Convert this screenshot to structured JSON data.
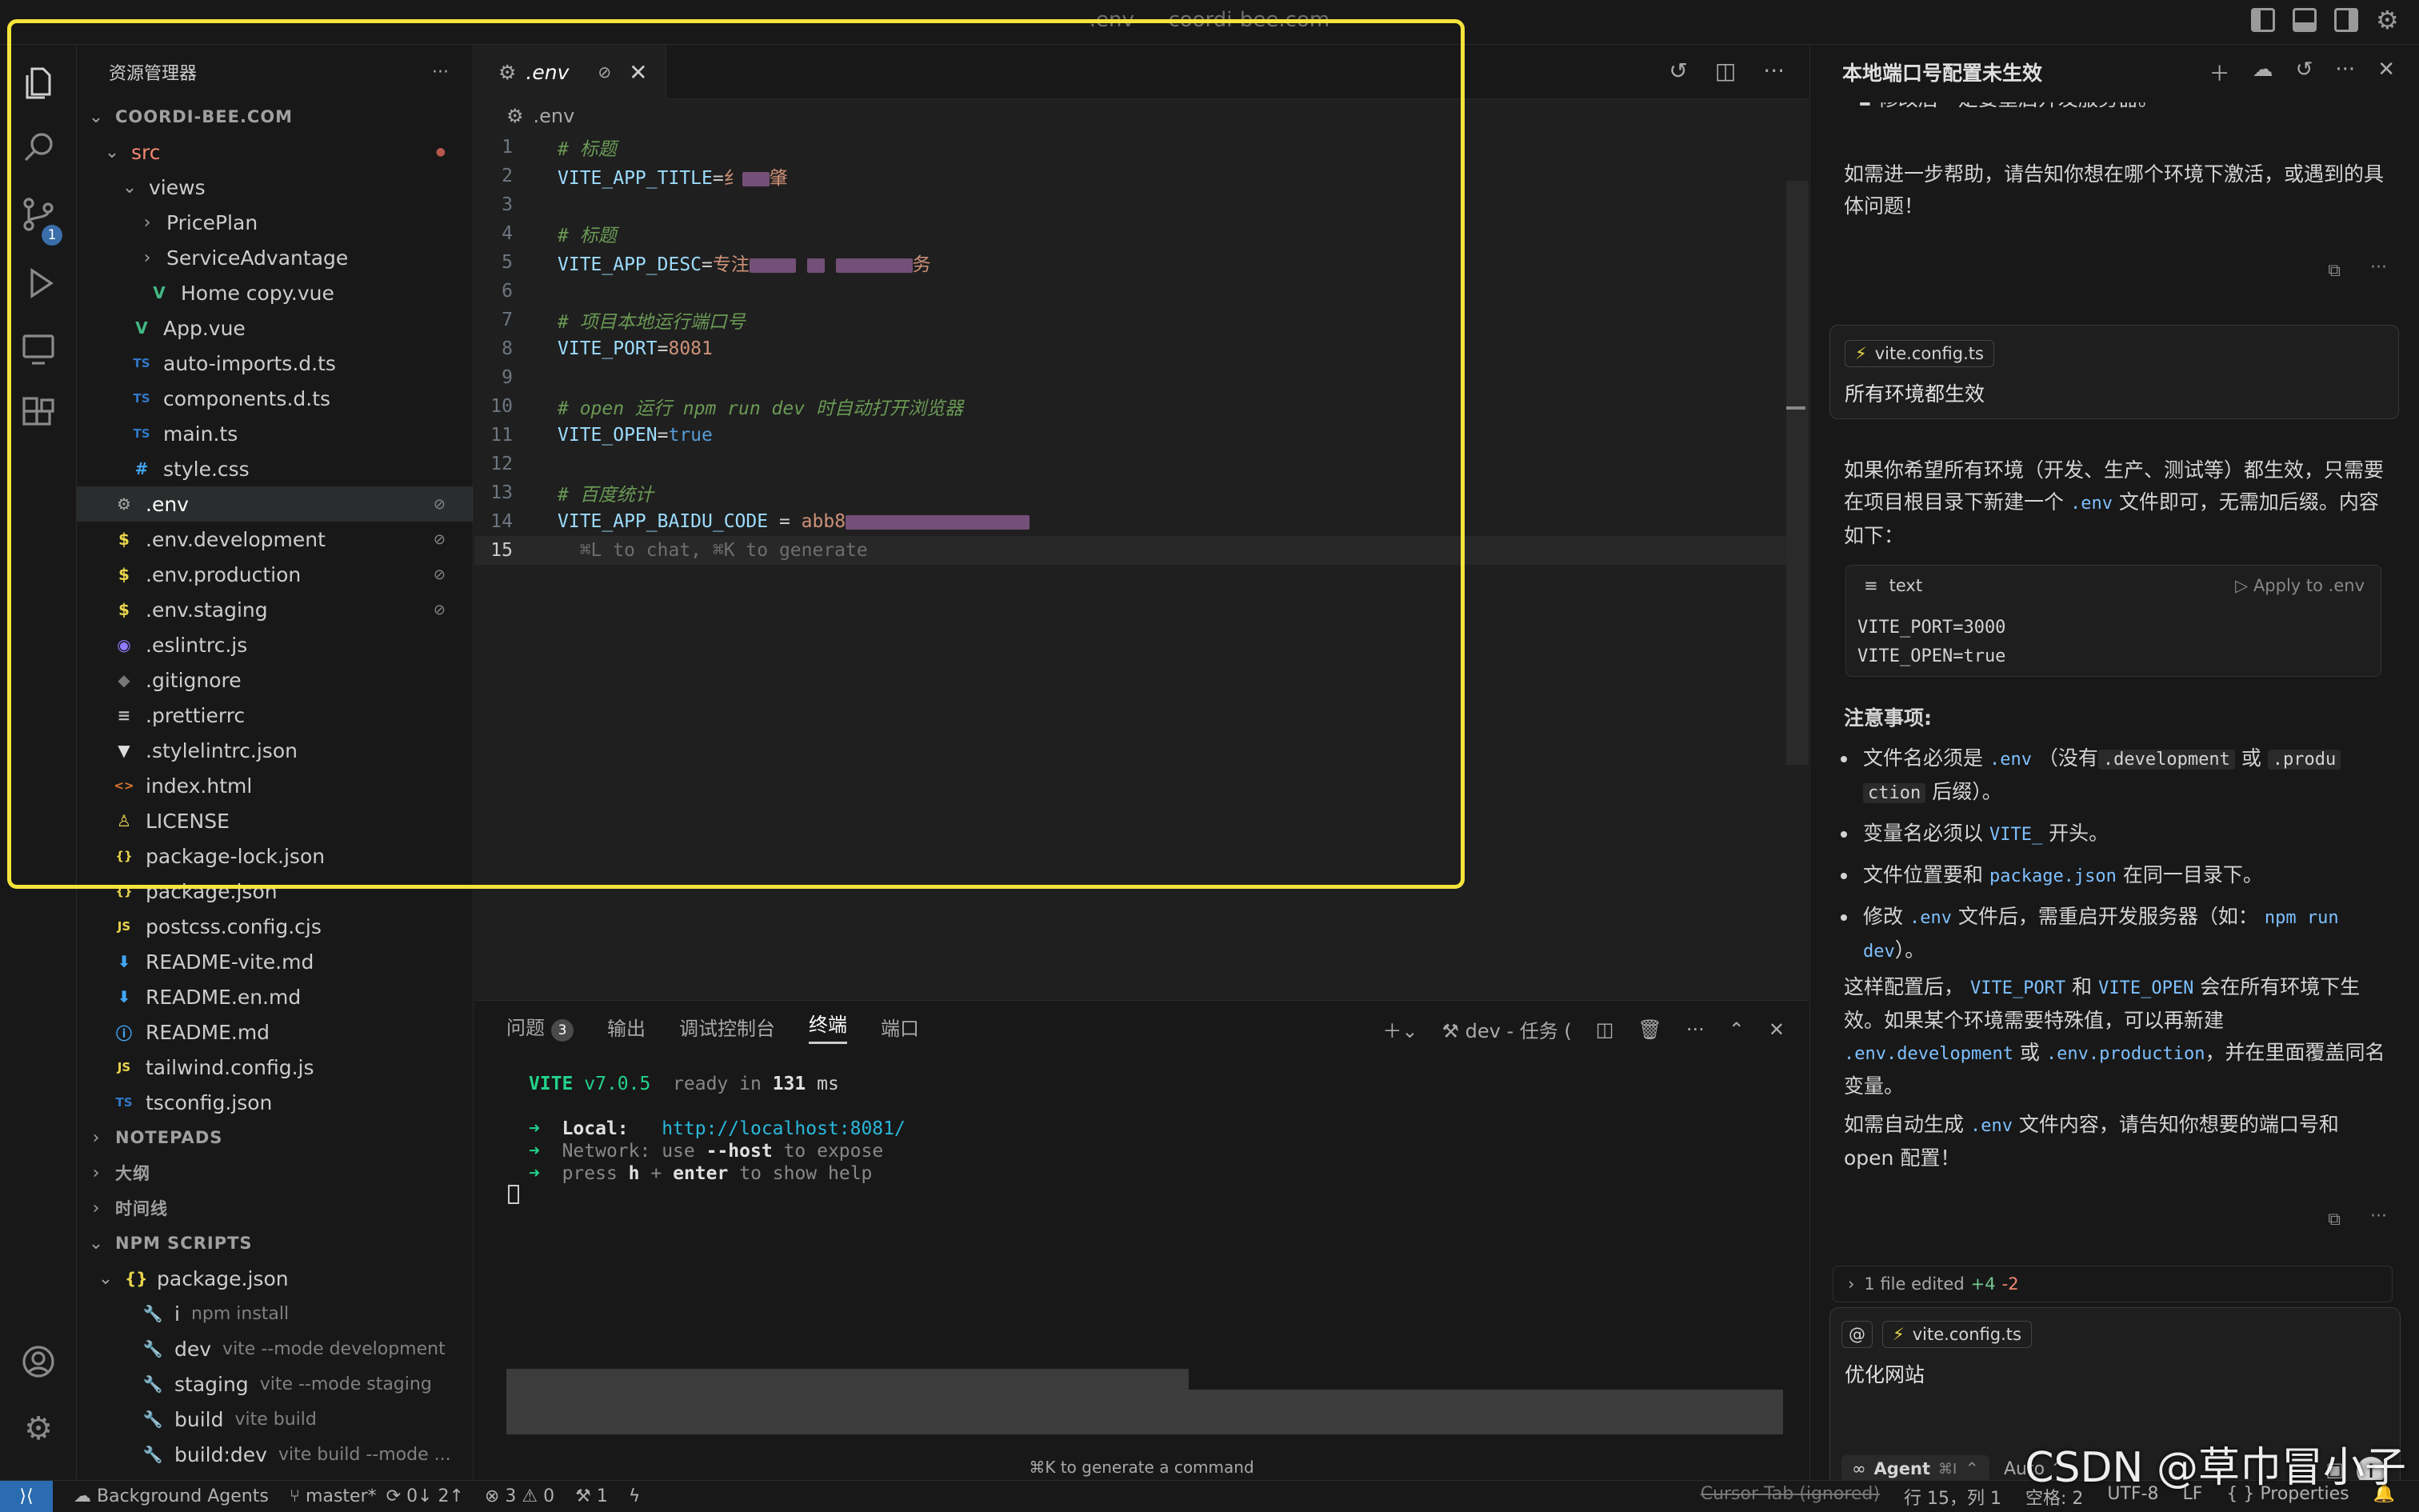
{
  "window": {
    "title": ".env — coordi-bee.com"
  },
  "explorer": {
    "title": "资源管理器",
    "more": "···",
    "project": "COORDI-BEE.COM",
    "files": [
      {
        "name": "src",
        "icon": "",
        "chev": "⌄",
        "indent": 0,
        "color": "#f48771",
        "mark": "●"
      },
      {
        "name": "views",
        "icon": "",
        "chev": "⌄",
        "indent": 1,
        "color": "#cccccc",
        "mark": ""
      },
      {
        "name": "PricePlan",
        "icon": "",
        "chev": "›",
        "indent": 2,
        "color": "#cccccc",
        "mark": ""
      },
      {
        "name": "ServiceAdvantage",
        "icon": "",
        "chev": "›",
        "indent": 2,
        "color": "#cccccc",
        "mark": ""
      },
      {
        "name": "Home copy.vue",
        "icon": "V",
        "chev": "",
        "indent": 2,
        "color": "#cccccc",
        "mark": "",
        "iconColor": "#41b883"
      },
      {
        "name": "App.vue",
        "icon": "V",
        "chev": "",
        "indent": 1,
        "color": "#cccccc",
        "mark": "",
        "iconColor": "#41b883"
      },
      {
        "name": "auto-imports.d.ts",
        "icon": "TS",
        "chev": "",
        "indent": 1,
        "color": "#cccccc",
        "mark": "",
        "iconColor": "#3178c6"
      },
      {
        "name": "components.d.ts",
        "icon": "TS",
        "chev": "",
        "indent": 1,
        "color": "#cccccc",
        "mark": "",
        "iconColor": "#3178c6"
      },
      {
        "name": "main.ts",
        "icon": "TS",
        "chev": "",
        "indent": 1,
        "color": "#cccccc",
        "mark": "",
        "iconColor": "#3178c6"
      },
      {
        "name": "style.css",
        "icon": "#",
        "chev": "",
        "indent": 1,
        "color": "#cccccc",
        "mark": "",
        "iconColor": "#42a5f5"
      },
      {
        "name": ".env",
        "icon": "⚙",
        "chev": "",
        "indent": 0,
        "color": "#ffffff",
        "mark": "⊘",
        "sel": true,
        "iconColor": "#aaaaaa"
      },
      {
        "name": ".env.development",
        "icon": "$",
        "chev": "",
        "indent": 0,
        "color": "#cccccc",
        "mark": "⊘",
        "iconColor": "#e8d44d"
      },
      {
        "name": ".env.production",
        "icon": "$",
        "chev": "",
        "indent": 0,
        "color": "#cccccc",
        "mark": "⊘",
        "iconColor": "#e8d44d"
      },
      {
        "name": ".env.staging",
        "icon": "$",
        "chev": "",
        "indent": 0,
        "color": "#cccccc",
        "mark": "⊘",
        "iconColor": "#e8d44d"
      },
      {
        "name": ".eslintrc.js",
        "icon": "◉",
        "chev": "",
        "indent": 0,
        "color": "#cccccc",
        "mark": "",
        "iconColor": "#8f7cff"
      },
      {
        "name": ".gitignore",
        "icon": "◆",
        "chev": "",
        "indent": 0,
        "color": "#cccccc",
        "mark": "",
        "iconColor": "#777777"
      },
      {
        "name": ".prettierrc",
        "icon": "≡",
        "chev": "",
        "indent": 0,
        "color": "#cccccc",
        "mark": "",
        "iconColor": "#bbbbbb"
      },
      {
        "name": ".stylelintrc.json",
        "icon": "▼",
        "chev": "",
        "indent": 0,
        "color": "#cccccc",
        "mark": "",
        "iconColor": "#dddddd"
      },
      {
        "name": "index.html",
        "icon": "<>",
        "chev": "",
        "indent": 0,
        "color": "#cccccc",
        "mark": "",
        "iconColor": "#e37933"
      },
      {
        "name": "LICENSE",
        "icon": "♙",
        "chev": "",
        "indent": 0,
        "color": "#cccccc",
        "mark": "",
        "iconColor": "#e8d44d"
      },
      {
        "name": "package-lock.json",
        "icon": "{}",
        "chev": "",
        "indent": 0,
        "color": "#cccccc",
        "mark": "",
        "iconColor": "#e8d44d"
      },
      {
        "name": "package.json",
        "icon": "{}",
        "chev": "",
        "indent": 0,
        "color": "#cccccc",
        "mark": "",
        "iconColor": "#e8d44d"
      },
      {
        "name": "postcss.config.cjs",
        "icon": "JS",
        "chev": "",
        "indent": 0,
        "color": "#cccccc",
        "mark": "",
        "iconColor": "#e8d44d"
      },
      {
        "name": "README-vite.md",
        "icon": "⬇",
        "chev": "",
        "indent": 0,
        "color": "#cccccc",
        "mark": "",
        "iconColor": "#42a5f5"
      },
      {
        "name": "README.en.md",
        "icon": "⬇",
        "chev": "",
        "indent": 0,
        "color": "#cccccc",
        "mark": "",
        "iconColor": "#42a5f5"
      },
      {
        "name": "README.md",
        "icon": "ⓘ",
        "chev": "",
        "indent": 0,
        "color": "#cccccc",
        "mark": "",
        "iconColor": "#42a5f5"
      },
      {
        "name": "tailwind.config.js",
        "icon": "JS",
        "chev": "",
        "indent": 0,
        "color": "#cccccc",
        "mark": "",
        "iconColor": "#e8d44d"
      },
      {
        "name": "tsconfig.json",
        "icon": "TS",
        "chev": "",
        "indent": 0,
        "color": "#cccccc",
        "mark": "",
        "iconColor": "#3178c6"
      }
    ],
    "sections": [
      "NOTEPADS",
      "大纲",
      "时间线",
      "NPM SCRIPTS"
    ],
    "npm": {
      "file": "package.json",
      "scripts": [
        {
          "name": "i",
          "cmd": "npm install"
        },
        {
          "name": "dev",
          "cmd": "vite --mode development"
        },
        {
          "name": "staging",
          "cmd": "vite --mode staging"
        },
        {
          "name": "build",
          "cmd": "vite build"
        },
        {
          "name": "build:dev",
          "cmd": "vite build --mode ..."
        }
      ]
    }
  },
  "editor": {
    "tab": ".env",
    "breadcrumb": ".env",
    "lines": [
      {
        "n": "1",
        "parts": [
          {
            "t": "# 标题",
            "c": "cmt"
          }
        ]
      },
      {
        "n": "2",
        "parts": [
          {
            "t": "VITE_APP_TITLE",
            "c": "key"
          },
          {
            "t": "=",
            "c": "plain"
          },
          {
            "t": "纟",
            "c": "val"
          },
          {
            "r": 34
          },
          {
            "t": "肇",
            "c": "val"
          }
        ]
      },
      {
        "n": "3",
        "parts": []
      },
      {
        "n": "4",
        "parts": [
          {
            "t": "# 标题",
            "c": "cmt"
          }
        ]
      },
      {
        "n": "5",
        "parts": [
          {
            "t": "VITE_APP_DESC",
            "c": "key"
          },
          {
            "t": "=",
            "c": "plain"
          },
          {
            "t": "专注",
            "c": "val"
          },
          {
            "r": 58
          },
          {
            "t": " ",
            "c": "plain"
          },
          {
            "r": 22
          },
          {
            "t": " ",
            "c": "plain"
          },
          {
            "r": 96
          },
          {
            "t": "务",
            "c": "val"
          }
        ]
      },
      {
        "n": "6",
        "parts": []
      },
      {
        "n": "7",
        "parts": [
          {
            "t": "# 项目本地运行端口号",
            "c": "cmt"
          }
        ]
      },
      {
        "n": "8",
        "parts": [
          {
            "t": "VITE_PORT",
            "c": "key"
          },
          {
            "t": "=",
            "c": "plain"
          },
          {
            "t": "8081",
            "c": "val"
          }
        ]
      },
      {
        "n": "9",
        "parts": []
      },
      {
        "n": "10",
        "parts": [
          {
            "t": "# open 运行 npm run dev 时自动打开浏览器",
            "c": "cmt"
          }
        ]
      },
      {
        "n": "11",
        "parts": [
          {
            "t": "VITE_OPEN",
            "c": "key"
          },
          {
            "t": "=",
            "c": "plain"
          },
          {
            "t": "true",
            "c": "bool"
          }
        ]
      },
      {
        "n": "12",
        "parts": []
      },
      {
        "n": "13",
        "parts": [
          {
            "t": "# 百度统计",
            "c": "cmt"
          }
        ]
      },
      {
        "n": "14",
        "parts": [
          {
            "t": "VITE_APP_BAIDU_CODE",
            "c": "key"
          },
          {
            "t": " = ",
            "c": "plain"
          },
          {
            "t": "a",
            "c": "val"
          },
          {
            "t": "bb8",
            "c": "val"
          },
          {
            "r": 230
          }
        ]
      },
      {
        "n": "15",
        "parts": [
          {
            "t": "  ⌘L to chat, ⌘K to generate",
            "c": "ghost"
          }
        ],
        "cur": true
      }
    ]
  },
  "panel": {
    "tabs": [
      "问题",
      "输出",
      "调试控制台",
      "终端",
      "端口"
    ],
    "problemsCount": "3",
    "activeTab": "终端",
    "taskLabel": "dev - 任务 (",
    "terminal": {
      "vite": "VITE",
      "version": "v7.0.5",
      "ready": "ready in",
      "ms": "131",
      "msUnit": "ms",
      "localLabel": "Local:",
      "localUrl": "http://localhost:8081/",
      "networkLabel": "Network:",
      "networkText1": "use",
      "networkFlag": "--host",
      "networkText2": "to expose",
      "helpText1": "press",
      "helpKey1": "h",
      "helpPlus": "+",
      "helpKey2": "enter",
      "helpText2": "to show help"
    },
    "genHint": "⌘K to generate a command"
  },
  "chat": {
    "title": "本地端口号配置未生效",
    "topCut": "修改后一定要重启开发服务器。",
    "p1": "如需进一步帮助，请告知你想在哪个环境下激活，或遇到的具体问题！",
    "userFile": "vite.config.ts",
    "userMsg": "所有环境都生效",
    "p2a": "如果你希望所有环境（开发、生产、测试等）都生效，只需要在项目根目录下新建一个",
    "p2code": ".env",
    "p2b": "文件即可，无需加后缀。内容如下：",
    "codeLang": "text",
    "codeApply": "Apply to .env",
    "codeLines": "VITE_PORT=3000\nVITE_OPEN=true",
    "notesTitle": "注意事项:",
    "b1a": "文件名必须是",
    "b1c1": ".env",
    "b1b": "（没有",
    "b1c2": ".development",
    "b1d": "或",
    "b1c3": ".produ",
    "b1c3b": "ction",
    "b1e": "后缀）。",
    "b2a": "变量名必须以",
    "b2c": "VITE_",
    "b2b": "开头。",
    "b3a": "文件位置要和",
    "b3c": "package.json",
    "b3b": "在同一目录下。",
    "b4a": "修改",
    "b4c": ".env",
    "b4b": "文件后，需重启开发服务器（如：",
    "b4c2": "npm run",
    "b4c2b": "dev",
    "b4d": "）。",
    "p3a": "这样配置后，",
    "p3c1": "VITE_PORT",
    "p3b": "和",
    "p3c2": "VITE_OPEN",
    "p3d": "会在所有环境下生效。如果某个环境需要特殊值，可以再新建",
    "p3c3a": ".env.deve",
    "p3c3b": "lopment",
    "p3e": "或",
    "p3c4": ".env.production",
    "p3f": "，并在里面覆盖同名变量。",
    "p4a": "如需自动生成",
    "p4c": ".env",
    "p4b": "文件内容，请告知你想要的端口号和open 配置！",
    "edited": "1 file edited",
    "editedPlus": "+4",
    "editedMinus": "-2",
    "composerFile": "vite.config.ts",
    "composerText": "优化网站",
    "agent": "Agent",
    "agentKey": "⌘I",
    "mode": "Auto"
  },
  "status": {
    "agents": "Background Agents",
    "branch": "master*",
    "sync": "0↓ 2↑",
    "errors": "3",
    "warnings": "0",
    "tools": "1",
    "cursorTab": "Cursor Tab (ignored)",
    "position": "行 15，列 1",
    "spaces": "空格: 2",
    "encoding": "UTF-8",
    "eol": "LF",
    "lang": "{ } Properties"
  },
  "watermark": "CSDN @草巾冒小子"
}
